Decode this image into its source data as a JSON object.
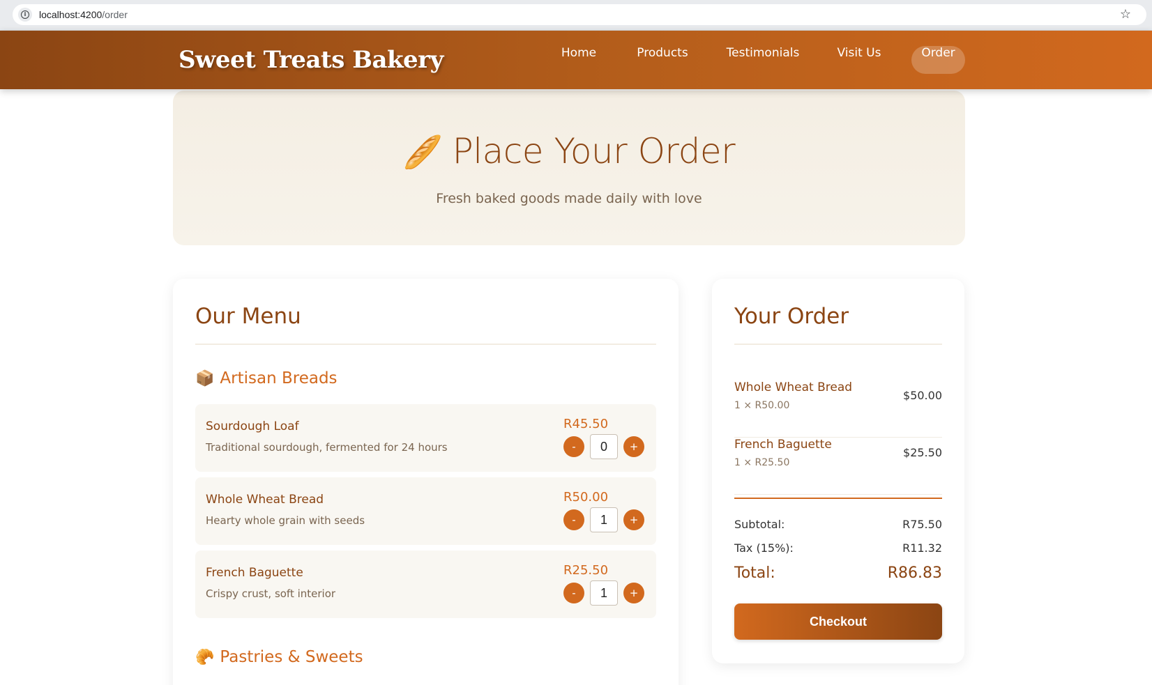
{
  "browser": {
    "url_host": "localhost:4200",
    "url_path": "/order",
    "info_icon": "info-icon",
    "bookmark_icon": "star-icon"
  },
  "header": {
    "logo": "Sweet Treats Bakery",
    "nav": [
      {
        "label": "Home",
        "active": false
      },
      {
        "label": "Products",
        "active": false
      },
      {
        "label": "Testimonials",
        "active": false
      },
      {
        "label": "Visit Us",
        "active": false
      },
      {
        "label": "Order",
        "active": true
      }
    ]
  },
  "hero": {
    "emoji": "🥖",
    "title": "Place Your Order",
    "subtitle": "Fresh baked goods made daily with love"
  },
  "menu": {
    "title": "Our Menu",
    "sections": [
      {
        "emoji": "📦",
        "title": "Artisan Breads",
        "items": [
          {
            "name": "Sourdough Loaf",
            "description": "Traditional sourdough, fermented for 24 hours",
            "price": "R45.50",
            "qty": "0"
          },
          {
            "name": "Whole Wheat Bread",
            "description": "Hearty whole grain with seeds",
            "price": "R50.00",
            "qty": "1"
          },
          {
            "name": "French Baguette",
            "description": "Crispy crust, soft interior",
            "price": "R25.50",
            "qty": "1"
          }
        ]
      },
      {
        "emoji": "🥐",
        "title": "Pastries & Sweets",
        "items": []
      }
    ],
    "minus_label": "-",
    "plus_label": "+"
  },
  "order": {
    "title": "Your Order",
    "lines": [
      {
        "name": "Whole Wheat Bread",
        "detail": "1 × R50.00",
        "total": "$50.00"
      },
      {
        "name": "French Baguette",
        "detail": "1 × R25.50",
        "total": "$25.50"
      }
    ],
    "subtotal_label": "Subtotal:",
    "subtotal_value": "R75.50",
    "tax_label": "Tax (15%):",
    "tax_value": "R11.32",
    "total_label": "Total:",
    "total_value": "R86.83",
    "checkout_label": "Checkout"
  },
  "colors": {
    "brand_dark": "#8b4513",
    "brand_accent": "#d2691e",
    "hero_bg": "#f5efe5",
    "item_bg": "#f9f7f2"
  }
}
